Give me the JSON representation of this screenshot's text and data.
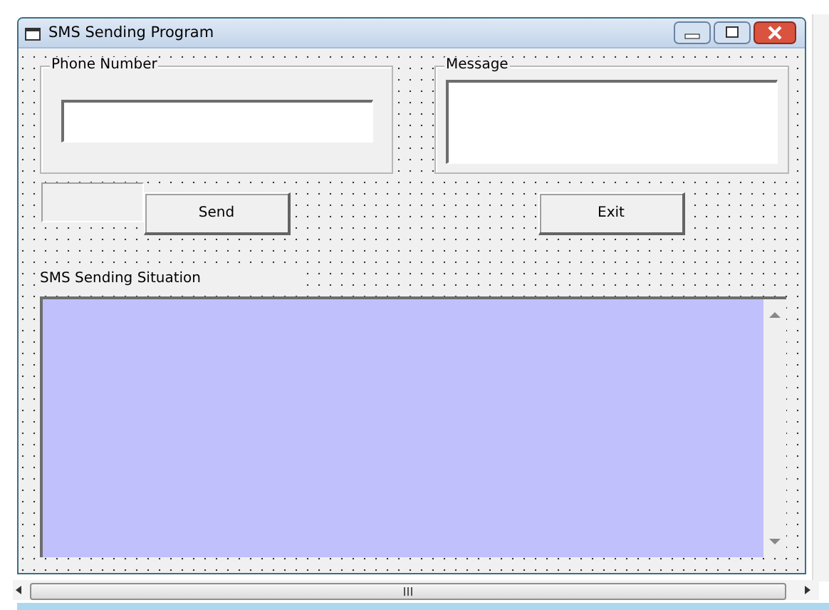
{
  "window": {
    "title": "SMS Sending Program"
  },
  "phone_frame": {
    "label": "Phone Number"
  },
  "message_frame": {
    "label": "Message"
  },
  "buttons": [
    {
      "kind": "send",
      "label": "Send"
    },
    {
      "kind": "exit",
      "label": "Exit"
    }
  ],
  "status": {
    "label": "SMS Sending Situation"
  }
}
